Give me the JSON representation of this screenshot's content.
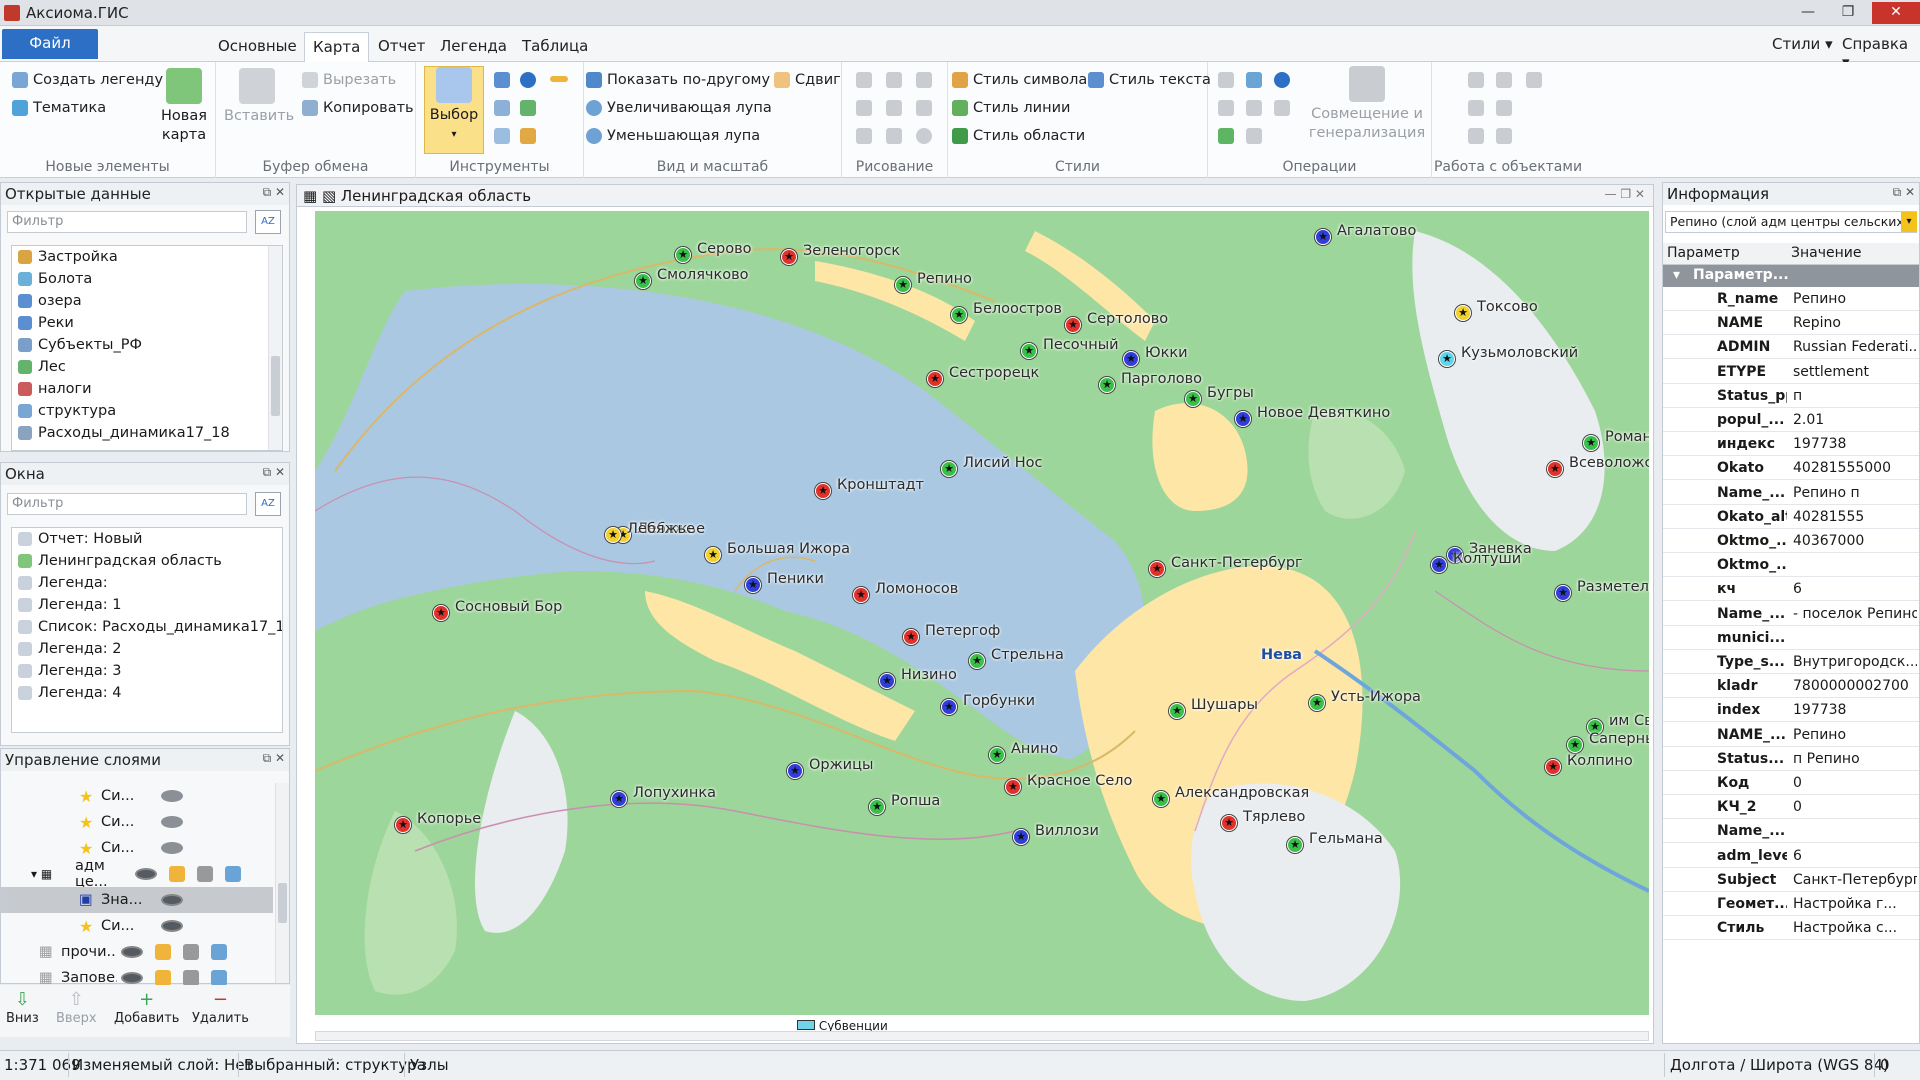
{
  "app": {
    "title": "Аксиома.ГИС"
  },
  "menu": {
    "file": "Файл",
    "tabs": [
      "Основные",
      "Карта",
      "Отчет",
      "Легенда",
      "Таблица"
    ],
    "right": [
      "Стили",
      "Справка"
    ]
  },
  "ribbon": {
    "new_elements": {
      "label": "Новые элементы",
      "create_legend": "Создать легенду",
      "thematic": "Тематика",
      "new_map": "Новая карта"
    },
    "clipboard": {
      "label": "Буфер обмена",
      "paste": "Вставить",
      "cut": "Вырезать",
      "copy": "Копировать"
    },
    "tools": {
      "label": "Инструменты",
      "select": "Выбор"
    },
    "view": {
      "label": "Вид и масштаб",
      "show_other": "Показать по-другому",
      "shift": "Сдвиг",
      "zoom_in": "Увеличивающая лупа",
      "zoom_out": "Уменьшающая лупа"
    },
    "drawing": {
      "label": "Рисование"
    },
    "styles": {
      "label": "Стили",
      "symbol_style": "Стиль символа",
      "text_style": "Стиль текста",
      "line_style": "Стиль линии",
      "area_style": "Стиль области"
    },
    "operations": {
      "label": "Операции",
      "combine": "Совмещение и генерализация"
    },
    "objects": {
      "label": "Работа с объектами"
    }
  },
  "open_data": {
    "title": "Открытые данные",
    "filter": "Фильтр",
    "items": [
      "Застройка",
      "Болота",
      "озера",
      "Реки",
      "Субъекты_РФ",
      "Лес",
      "налоги",
      "структура",
      "Расходы_динамика17_18"
    ]
  },
  "windows": {
    "title": "Окна",
    "filter": "Фильтр",
    "items": [
      "Отчет: Новый",
      "Ленинградская область",
      "Легенда:",
      "Легенда:  1",
      "Список: Расходы_динамика17_18",
      "Легенда:  2",
      "Легенда:  3",
      "Легенда:  4"
    ]
  },
  "layers": {
    "title": "Управление слоями",
    "rows": [
      "Си...",
      "Си...",
      "Си...",
      "адм це...",
      "Зна...",
      "Си...",
      "прочи...",
      "Запове..."
    ],
    "down": "Вниз",
    "up": "Вверх",
    "add": "Добавить",
    "remove": "Удалить"
  },
  "map": {
    "title": "Ленинградская область",
    "legend_hint": "Субвенции",
    "labels": [
      "Агалатово",
      "Серово",
      "Зеленогорск",
      "Смолячково",
      "Репино",
      "Белоостров",
      "Токсово",
      "Сертолово",
      "Песочный",
      "Юкки",
      "Кузьмоловский",
      "Сестрорецк",
      "Парголово",
      "Бугры",
      "Новое Девяткино",
      "Романов",
      "Всеволожск",
      "Лисий Нос",
      "Кронштадт",
      "Лебяжье",
      "Большая Ижора",
      "Заневка",
      "Колтуши",
      "Санкт-Петербург",
      "Лебяжье",
      "Пеники",
      "Ломоносов",
      "Разметелев",
      "Сосновый Бор",
      "Петергоф",
      "Стрельна",
      "Нева",
      "Низино",
      "Горбунки",
      "Шушары",
      "Усть-Ижора",
      "им Свердло",
      "Саперный",
      "Колпино",
      "Анино",
      "Красное Село",
      "Оржицы",
      "Лопухинка",
      "Ропша",
      "Александровская",
      "Тярлево",
      "Копорье",
      "Виллози",
      "Гельмана"
    ]
  },
  "info": {
    "title": "Информация",
    "selector": "Репино (слой адм центры сельских по",
    "col_param": "Параметр",
    "col_value": "Значение",
    "group": "Параметр...",
    "rows": [
      [
        "R_name",
        "Репино"
      ],
      [
        "NAME",
        "Repino"
      ],
      [
        "ADMIN",
        "Russian Federati..."
      ],
      [
        "ETYPE",
        "settlement"
      ],
      [
        "Status_pp",
        "п"
      ],
      [
        "popul_...",
        "2.01"
      ],
      [
        "индекс",
        "197738"
      ],
      [
        "Okato",
        "40281555000"
      ],
      [
        "Name_...",
        "Репино п"
      ],
      [
        "Okato_alt",
        "40281555"
      ],
      [
        "Oktmo_...",
        "40367000"
      ],
      [
        "Oktmo_...",
        ""
      ],
      [
        "кч",
        "6"
      ],
      [
        "Name_...",
        "- поселок Репино"
      ],
      [
        "munici...",
        ""
      ],
      [
        "Type_s...",
        "Внутригородск..."
      ],
      [
        "kladr",
        "7800000002700"
      ],
      [
        "index",
        "197738"
      ],
      [
        "NAME_...",
        "Репино"
      ],
      [
        "Status...",
        "п Репино"
      ],
      [
        "Код",
        "0"
      ],
      [
        "КЧ_2",
        "0"
      ],
      [
        "Name_...",
        ""
      ],
      [
        "adm_level",
        "6"
      ],
      [
        "Subject",
        "Санкт-Петербург"
      ],
      [
        "Геомет...",
        "Настройка г..."
      ],
      [
        "Стиль",
        "Настройка с..."
      ]
    ]
  },
  "status": {
    "scale": "1:371 069",
    "editable": "Изменяемый слой: Нет",
    "selected": "Выбранный: структура",
    "nodes": "Узлы",
    "coords": "Долгота / Широта (WGS 84)",
    "count": "0"
  },
  "colors": {
    "accent": "#2d6fc4",
    "water": "#aac8e2",
    "land": "#9dd69a",
    "urban": "#fde6a6"
  }
}
